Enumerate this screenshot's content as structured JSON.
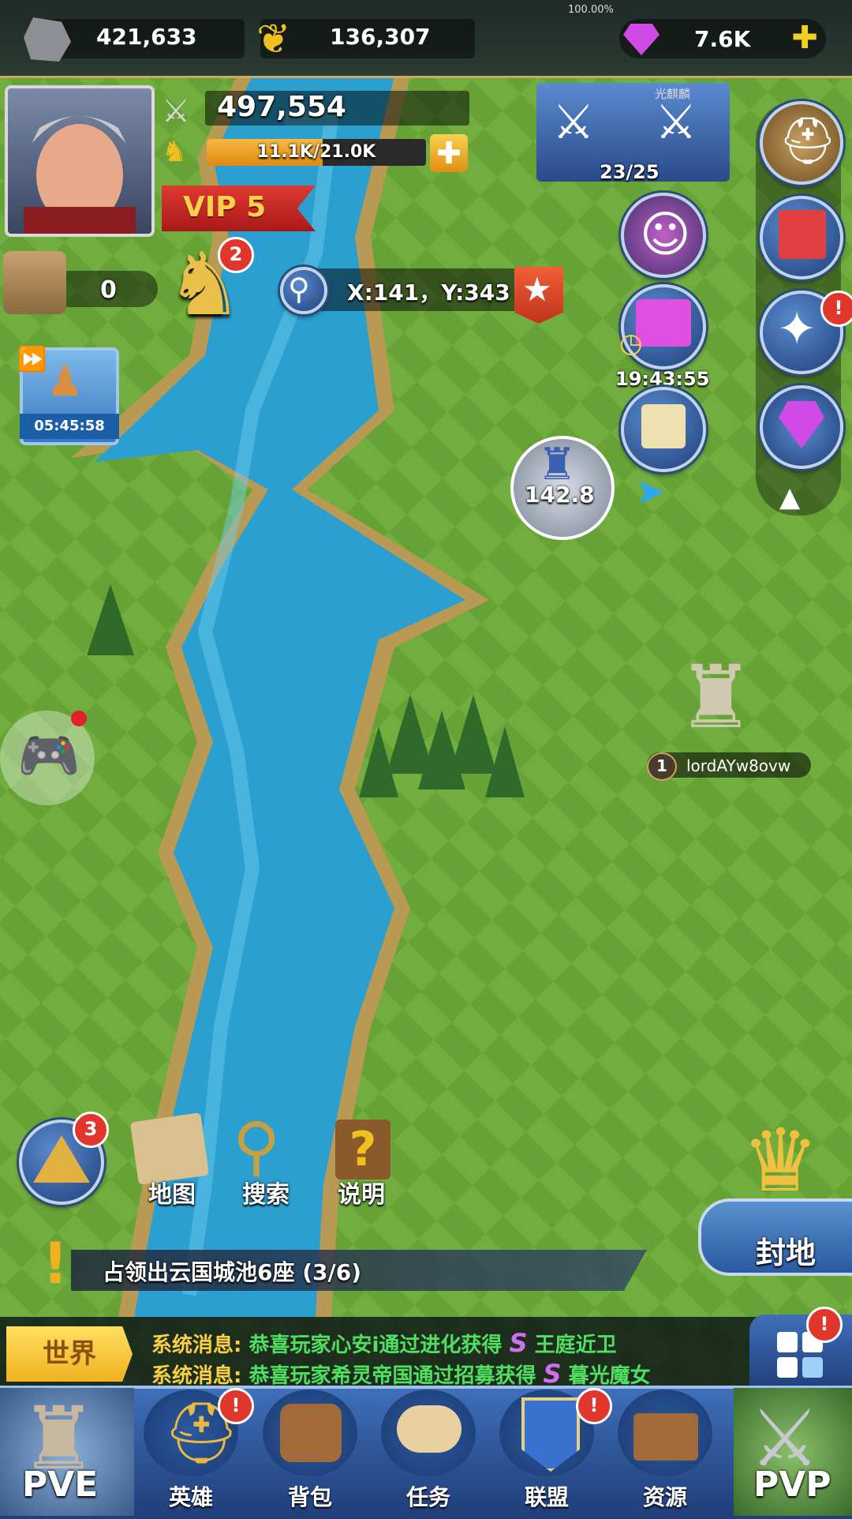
{
  "resources": {
    "stone": "421,633",
    "wheat": "136,307",
    "gems": "7.6K",
    "top_progress": "100.00%"
  },
  "player": {
    "power": "497,554",
    "exp": "11.1K/21.0K",
    "vip": "VIP 5"
  },
  "city_count": "0",
  "knight_badge": "2",
  "coords": "X:141，Y:343",
  "event_progress": "23/25",
  "event_name": "光麒麟",
  "timers": {
    "chest": "19:43:55",
    "boost": "05:45:58"
  },
  "castle_value": "142.8",
  "enemy": {
    "level": "1",
    "name": "lordAYw8ovw"
  },
  "left_badge": "3",
  "tools": {
    "map": "地图",
    "search": "搜索",
    "help": "说明"
  },
  "quest": "占领出云国城池6座 (3/6)",
  "fief_label": "封地",
  "chat": {
    "tab": "世界",
    "messages": [
      {
        "prefix": "系统消息:",
        "text": "恭喜玩家心安i通过进化获得",
        "rank": "S",
        "reward": "王庭近卫"
      },
      {
        "prefix": "系统消息:",
        "text": "恭喜玩家希灵帝国通过招募获得",
        "rank": "S",
        "reward": "暮光魔女"
      }
    ]
  },
  "nav": {
    "pve": "PVE",
    "pvp": "PVP",
    "hero": "英雄",
    "bag": "背包",
    "task": "任务",
    "alliance": "联盟",
    "resource": "资源"
  },
  "colors": {
    "grass": "#6aa63a",
    "river": "#2a9fd0",
    "gold": "#f0c020",
    "alert_red": "#e0362c",
    "nav_blue": "#2b5aa0"
  }
}
